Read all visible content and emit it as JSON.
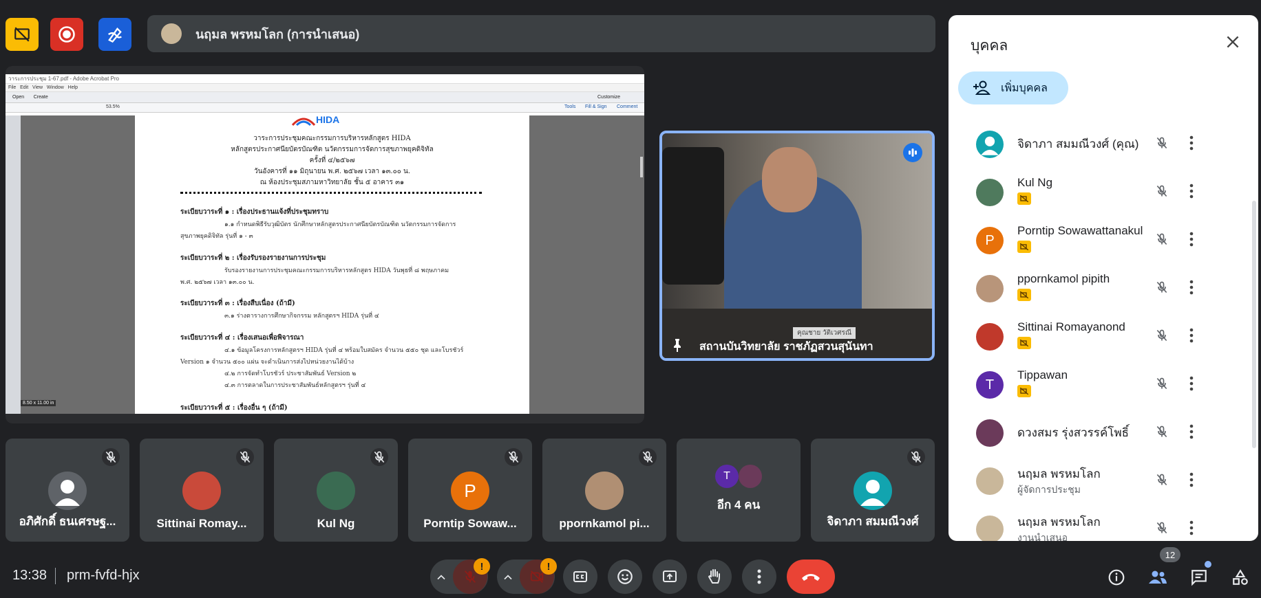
{
  "presenter": {
    "name": "นฤมล พรหมโลก (การนำเสนอ)"
  },
  "acrobat": {
    "title": "วาระการประชุม 1-67.pdf - Adobe Acrobat Pro",
    "menu": [
      "File",
      "Edit",
      "View",
      "Window",
      "Help"
    ],
    "toolbar_labels": [
      "Open",
      "Create"
    ],
    "right_tools": [
      "Tools",
      "Fill & Sign",
      "Comment"
    ],
    "zoom": "53.5%",
    "page_size": "8.50 x 11.00 in",
    "customize": "Customize"
  },
  "document": {
    "logo_text": "HIDA",
    "logo_subtext": "Health Innovation Digital Age",
    "heading_lines": [
      "วาระการประชุมคณะกรรมการบริหารหลักสูตร HIDA",
      "หลักสูตรประกาศนียบัตรบัณฑิต นวัตกรรมการจัดการสุขภาพยุคดิจิทัล",
      "ครั้งที่ ๔/๒๕๖๗",
      "วันอังคารที่ ๑๑ มิถุนายน พ.ศ. ๒๕๖๗ เวลา ๑๓.๐๐ น.",
      "ณ ห้องประชุมสภามหาวิทยาลัย ชั้น ๕ อาคาร ๓๑"
    ],
    "agenda": [
      {
        "heading": "ระเบียบวาระที่ ๑ : เรื่องประธานแจ้งที่ประชุมทราบ",
        "lines": [
          "๑.๑ กำหนดพิธีรับวุฒิบัตร นักศึกษาหลักสูตรประกาศนียบัตรบัณฑิต นวัตกรรมการจัดการ",
          "สุขภาพยุคดิจิทัล รุ่นที่ ๑ - ๓"
        ]
      },
      {
        "heading": "ระเบียบวาระที่ ๒ : เรื่องรับรองรายงานการประชุม",
        "lines": [
          "รับรองรายงานการประชุมคณะกรรมการบริหารหลักสูตร HIDA วันพุธที่ ๘ พฤษภาคม",
          "พ.ศ. ๒๕๖๗ เวลา ๑๓.๐๐ น."
        ]
      },
      {
        "heading": "ระเบียบวาระที่ ๓ : เรื่องสืบเนื่อง (ถ้ามี)",
        "lines": [
          "๓.๑ ร่างตารางการศึกษากิจกรรม หลักสูตรฯ HIDA รุ่นที่ ๔"
        ]
      },
      {
        "heading": "ระเบียบวาระที่ ๔ : เรื่องเสนอเพื่อพิจารณา",
        "lines": [
          "๔.๑ ข้อมูลโครงการหลักสูตรฯ HIDA รุ่นที่ ๔ พร้อมใบสมัคร จำนวน ๕๕๐ ชุด และโบรชัวร์",
          "Version ๑ จำนวน ๕๐๐ แผ่น จะดำเนินการส่งไปหน่วยงานได้บ้าง",
          "๔.๒ การจัดทำโบรชัวร์ ประชาสัมพันธ์ Version ๒",
          "๔.๓ การตลาดในการประชาสัมพันธ์หลักสูตรฯ รุ่นที่ ๔"
        ]
      },
      {
        "heading": "ระเบียบวาระที่ ๕ : เรื่องอื่น ๆ (ถ้ามี)",
        "lines": []
      }
    ]
  },
  "featured": {
    "label": "สถานบันวิทยาลัย ราชภัฏสวนสุนันทา",
    "nameplate": "คุณชาย วัติเวศรณี"
  },
  "tiles": [
    {
      "name": "อภิศักดิ์ ธนเศรษฐ...",
      "type": "default",
      "color": "#5f6368"
    },
    {
      "name": "Sittinai Romay...",
      "type": "photo",
      "color": "#c94a3a"
    },
    {
      "name": "Kul Ng",
      "type": "photo",
      "color": "#3a6b52"
    },
    {
      "name": "Porntip Sowaw...",
      "type": "letter",
      "letter": "P",
      "color": "#e8710a"
    },
    {
      "name": "ppornkamol pi...",
      "type": "photo",
      "color": "#b08f73"
    },
    {
      "name": "อีก 4 คน",
      "type": "more",
      "letter": "T",
      "color": "#5b2aa8"
    },
    {
      "name": "จิดาภา สมมณีวงศ์",
      "type": "default",
      "color": "#12a4af"
    }
  ],
  "panel": {
    "title": "บุคคล",
    "add_label": "เพิ่มบุคคล",
    "people": [
      {
        "name": "จิดาภา สมมณีวงศ์ (คุณ)",
        "avatar": "default",
        "color": "#12a4af",
        "badge": false,
        "sub": ""
      },
      {
        "name": "Kul Ng",
        "avatar": "photo",
        "color": "#4f7a5d",
        "badge": true,
        "sub": ""
      },
      {
        "name": "Porntip Sowawattanakul",
        "avatar": "letter",
        "letter": "P",
        "color": "#e8710a",
        "badge": true,
        "sub": ""
      },
      {
        "name": "ppornkamol pipith",
        "avatar": "photo",
        "color": "#b8957a",
        "badge": true,
        "sub": ""
      },
      {
        "name": "Sittinai Romayanond",
        "avatar": "photo",
        "color": "#c0392b",
        "badge": true,
        "sub": ""
      },
      {
        "name": "Tippawan",
        "avatar": "letter",
        "letter": "T",
        "color": "#5b2aa8",
        "badge": true,
        "sub": ""
      },
      {
        "name": "ดวงสมร รุ่งสวรรค์โพธิ์",
        "avatar": "photo",
        "color": "#6b3a5a",
        "badge": false,
        "sub": ""
      },
      {
        "name": "นฤมล พรหมโลก",
        "avatar": "photo",
        "color": "#c9b79a",
        "badge": false,
        "sub": "ผู้จัดการประชุม"
      },
      {
        "name": "นฤมล พรหมโลก",
        "avatar": "photo",
        "color": "#c9b79a",
        "badge": false,
        "sub": "งานนำเสนอ"
      }
    ]
  },
  "bottom": {
    "time": "13:38",
    "code": "prm-fvfd-hjx",
    "people_count": "12",
    "warn": "!"
  }
}
